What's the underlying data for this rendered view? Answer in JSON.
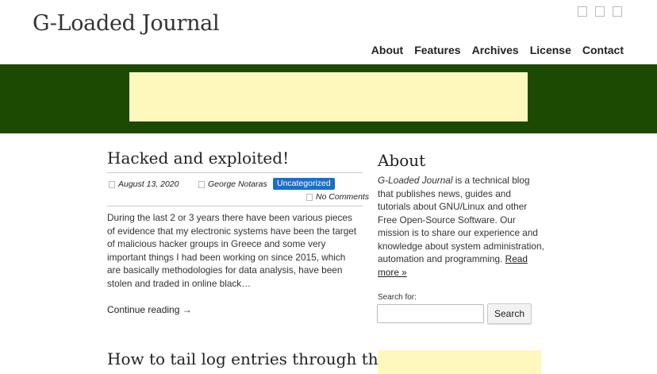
{
  "site": {
    "title": "G-Loaded Journal"
  },
  "social_icons": [
    "social-icon",
    "social-icon",
    "social-icon"
  ],
  "nav": {
    "items": [
      "About",
      "Features",
      "Archives",
      "License",
      "Contact"
    ]
  },
  "post1": {
    "title": "Hacked and exploited!",
    "date": "August 13, 2020",
    "author": "George Notaras",
    "category": "Uncategorized",
    "comments": "No Comments",
    "excerpt": "During the last 2 or 3 years there have been various pieces of evidence that my electronic systems have been the target of malicious hacker groups in Greece and some very important things I had been working on since 2015, which are basically methodologies for data analysis, have been stolen and traded in online black…",
    "continue": "Continue reading →"
  },
  "post2": {
    "title": "How to tail log entries through the"
  },
  "sidebar": {
    "about_title": "About",
    "about_em": "G-Loaded Journal",
    "about_text": " is a technical blog that publishes news, guides and tutorials about GNU/Linux and other Free Open-Source Software. Our mission is to share our experience and knowledge about system administration, automation and programming. ",
    "read_more": "Read more »",
    "search_label": "Search for:",
    "search_value": "",
    "search_button": "Search"
  },
  "colors": {
    "banner_bg": "#1c4a03",
    "ad_bg": "#fff8bd",
    "category_badge": "#1d6fc4"
  }
}
